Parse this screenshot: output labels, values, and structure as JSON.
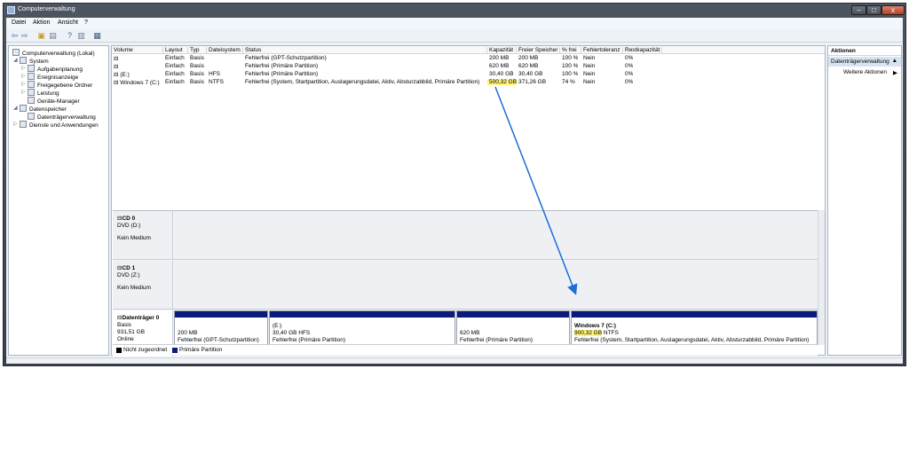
{
  "window": {
    "title": "Computerverwaltung"
  },
  "menu": [
    "Datei",
    "Aktion",
    "Ansicht",
    "?"
  ],
  "toolbar_icons": [
    "back-arrow-icon",
    "forward-arrow-icon",
    "up-folder-icon",
    "show-hide-tree-icon",
    "help-icon",
    "properties-icon",
    "disk-view-icon"
  ],
  "tree": {
    "root": "Computerverwaltung (Lokal)",
    "system": "System",
    "aufgabenplanung": "Aufgabenplanung",
    "ereignisanzeige": "Ereignisanzeige",
    "freigegebene_ordner": "Freigegebene Ordner",
    "leistung": "Leistung",
    "geraete_manager": "Geräte-Manager",
    "datenspeicher": "Datenspeicher",
    "datentraegerverwaltung": "Datenträgerverwaltung",
    "dienste": "Dienste und Anwendungen"
  },
  "volumes": {
    "headers": {
      "volume": "Volume",
      "layout": "Layout",
      "typ": "Typ",
      "dateisystem": "Dateisystem",
      "status": "Status",
      "kapazitaet": "Kapazität",
      "freier_speicher": "Freier Speicher",
      "prozent_frei": "% frei",
      "fehlertoleranz": "Fehlertoleranz",
      "restkapazitaet": "Restkapazität"
    },
    "rows": [
      {
        "volume": "",
        "layout": "Einfach",
        "typ": "Basis",
        "dateisystem": "",
        "status": "Fehlerfrei (GPT-Schutzpartition)",
        "kapazitaet": "200 MB",
        "frei": "200 MB",
        "prozent": "100 %",
        "fehlertoleranz": "Nein",
        "rest": "0%"
      },
      {
        "volume": "",
        "layout": "Einfach",
        "typ": "Basis",
        "dateisystem": "",
        "status": "Fehlerfrei (Primäre Partition)",
        "kapazitaet": "620 MB",
        "frei": "620 MB",
        "prozent": "100 %",
        "fehlertoleranz": "Nein",
        "rest": "0%"
      },
      {
        "volume": "(E:)",
        "layout": "Einfach",
        "typ": "Basis",
        "dateisystem": "HFS",
        "status": "Fehlerfrei (Primäre Partition)",
        "kapazitaet": "30,40 GB",
        "frei": "30,40 GB",
        "prozent": "100 %",
        "fehlertoleranz": "Nein",
        "rest": "0%"
      },
      {
        "volume": "Windows 7 (C:)",
        "layout": "Einfach",
        "typ": "Basis",
        "dateisystem": "NTFS",
        "status": "Fehlerfrei (System, Startpartition, Auslagerungsdatei, Aktiv, Absturzabbild, Primäre Partition)",
        "kapazitaet": "500,32 GB",
        "frei": "371,26 GB",
        "prozent": "74 %",
        "fehlertoleranz": "Nein",
        "rest": "0%"
      }
    ]
  },
  "disks": {
    "cd0": {
      "name": "CD 0",
      "drive": "DVD (D:)",
      "state": "Kein Medium"
    },
    "cd1": {
      "name": "CD 1",
      "drive": "DVD (Z:)",
      "state": "Kein Medium"
    },
    "disk0": {
      "name": "Datenträger 0",
      "type": "Basis",
      "size": "931,51 GB",
      "state": "Online",
      "partitions": [
        {
          "title": "",
          "size": "200 MB",
          "status": "Fehlerfrei (GPT-Schutzpartition)"
        },
        {
          "title": "(E:)",
          "size": "30,40 GB HFS",
          "status": "Fehlerfrei (Primäre Partition)"
        },
        {
          "title": "",
          "size": "620 MB",
          "status": "Fehlerfrei (Primäre Partition)"
        },
        {
          "title": "Windows 7  (C:)",
          "size_hl": "900,32 GB",
          "size_rest": " NTFS",
          "status": "Fehlerfrei (System, Startpartition, Auslagerungsdatei, Aktiv, Absturzabbild, Primäre Partition)"
        }
      ]
    }
  },
  "legend": {
    "unallocated": "Nicht zugeordnet",
    "primary": "Primäre Partition",
    "unallocated_color": "#000000",
    "primary_color": "#0a1b7a"
  },
  "actions": {
    "header": "Aktionen",
    "section": "Datenträgerverwaltung",
    "more": "Weitere Aktionen"
  },
  "colors": {
    "highlight": "#fff27a",
    "arrow": "#1a6fd6",
    "partition_bar": "#0a1b7a"
  }
}
